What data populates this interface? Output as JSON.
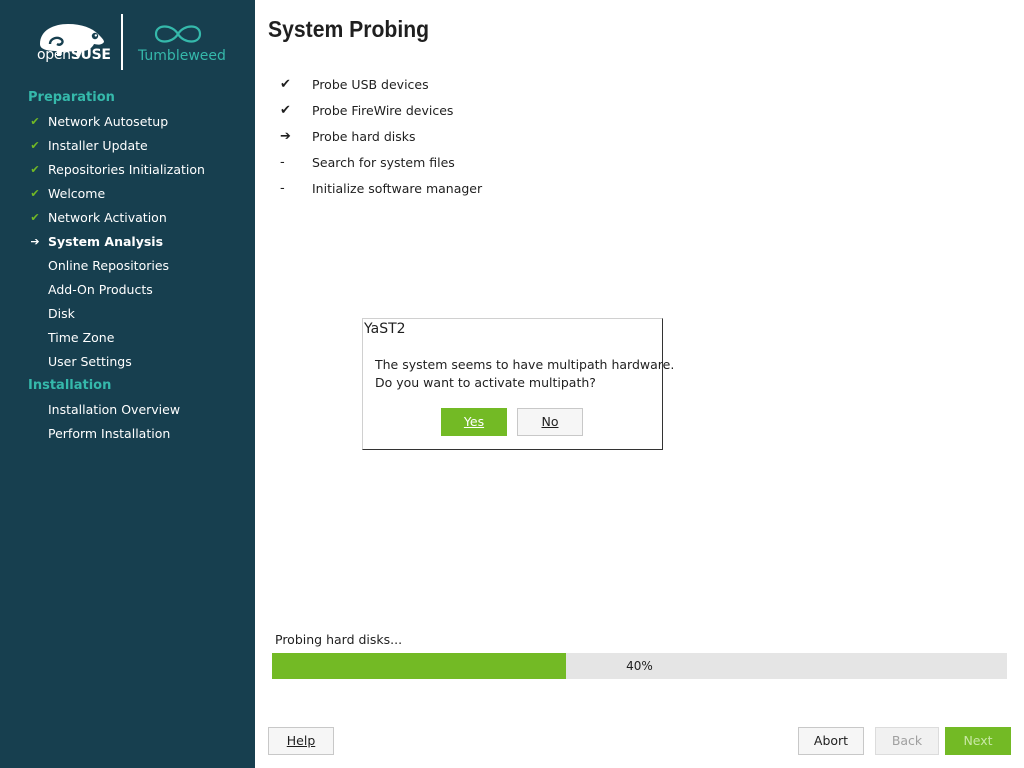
{
  "brand": {
    "distro_prefix": "open",
    "distro_suffix": "SUSE",
    "edition": "Tumbleweed",
    "colors": {
      "sidebar_bg": "#173f4f",
      "accent_teal": "#35b9ab",
      "accent_green": "#73ba25"
    }
  },
  "sidebar": {
    "sections": [
      {
        "heading": "Preparation",
        "steps": [
          {
            "label": "Network Autosetup",
            "status": "done",
            "mark": "✔"
          },
          {
            "label": "Installer Update",
            "status": "done",
            "mark": "✔"
          },
          {
            "label": "Repositories Initialization",
            "status": "done",
            "mark": "✔"
          },
          {
            "label": "Welcome",
            "status": "done",
            "mark": "✔"
          },
          {
            "label": "Network Activation",
            "status": "done",
            "mark": "✔"
          },
          {
            "label": "System Analysis",
            "status": "current",
            "mark": "➔"
          },
          {
            "label": "Online Repositories",
            "status": "pending",
            "mark": ""
          },
          {
            "label": "Add-On Products",
            "status": "pending",
            "mark": ""
          },
          {
            "label": "Disk",
            "status": "pending",
            "mark": ""
          },
          {
            "label": "Time Zone",
            "status": "pending",
            "mark": ""
          },
          {
            "label": "User Settings",
            "status": "pending",
            "mark": ""
          }
        ]
      },
      {
        "heading": "Installation",
        "steps": [
          {
            "label": "Installation Overview",
            "status": "pending",
            "mark": ""
          },
          {
            "label": "Perform Installation",
            "status": "pending",
            "mark": ""
          }
        ]
      }
    ]
  },
  "main": {
    "title": "System Probing",
    "probe_items": [
      {
        "mark": "✔",
        "label": "Probe USB devices"
      },
      {
        "mark": "✔",
        "label": "Probe FireWire devices"
      },
      {
        "mark": "➔",
        "label": "Probe hard disks"
      },
      {
        "mark": "-",
        "label": "Search for system files"
      },
      {
        "mark": "-",
        "label": "Initialize software manager"
      }
    ]
  },
  "dialog": {
    "title": "YaST2",
    "message_line1": "The system seems to have multipath hardware.",
    "message_line2": "Do you want to activate multipath?",
    "yes_label": "Yes",
    "no_label": "No"
  },
  "progress": {
    "label": "Probing hard disks...",
    "percent": 40,
    "percent_text": "40%"
  },
  "buttons": {
    "help": "Help",
    "abort": "Abort",
    "back": "Back",
    "next": "Next"
  }
}
